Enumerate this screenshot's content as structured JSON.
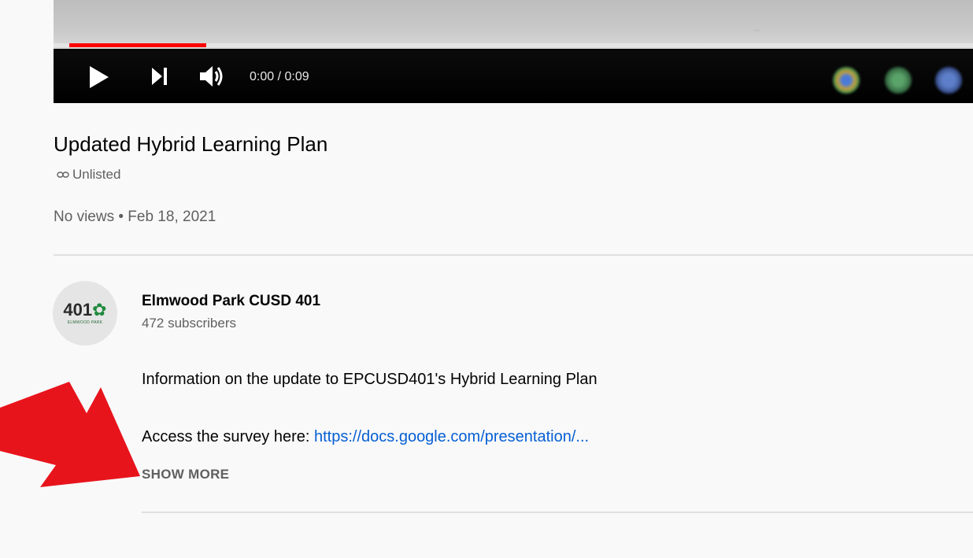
{
  "player": {
    "time": "0:00 / 0:09",
    "progress_fraction": 0.15,
    "caption_text": "...",
    "controls": [
      "play-icon",
      "next-icon",
      "volume-icon"
    ],
    "colors": {
      "progress": "#ff0000",
      "bar_bg": "#000000"
    }
  },
  "video": {
    "title": "Updated Hybrid Learning Plan",
    "visibility": "Unlisted",
    "visibility_icon": "link-icon",
    "meta": "No views • Feb 18, 2021"
  },
  "channel": {
    "avatar_text": "401",
    "avatar_subtext": "ELMWOOD PARK",
    "name": "Elmwood Park CUSD 401",
    "subscribers": "472 subscribers"
  },
  "description": {
    "line1": "Information on the update to EPCUSD401's Hybrid Learning Plan",
    "line2_prefix": "Access the survey here: ",
    "line2_link": "https://docs.google.com/presentation/...",
    "show_more": "SHOW MORE"
  },
  "colors": {
    "link": "#065fd4",
    "secondary_text": "#606060",
    "arrow": "#e8141c"
  }
}
